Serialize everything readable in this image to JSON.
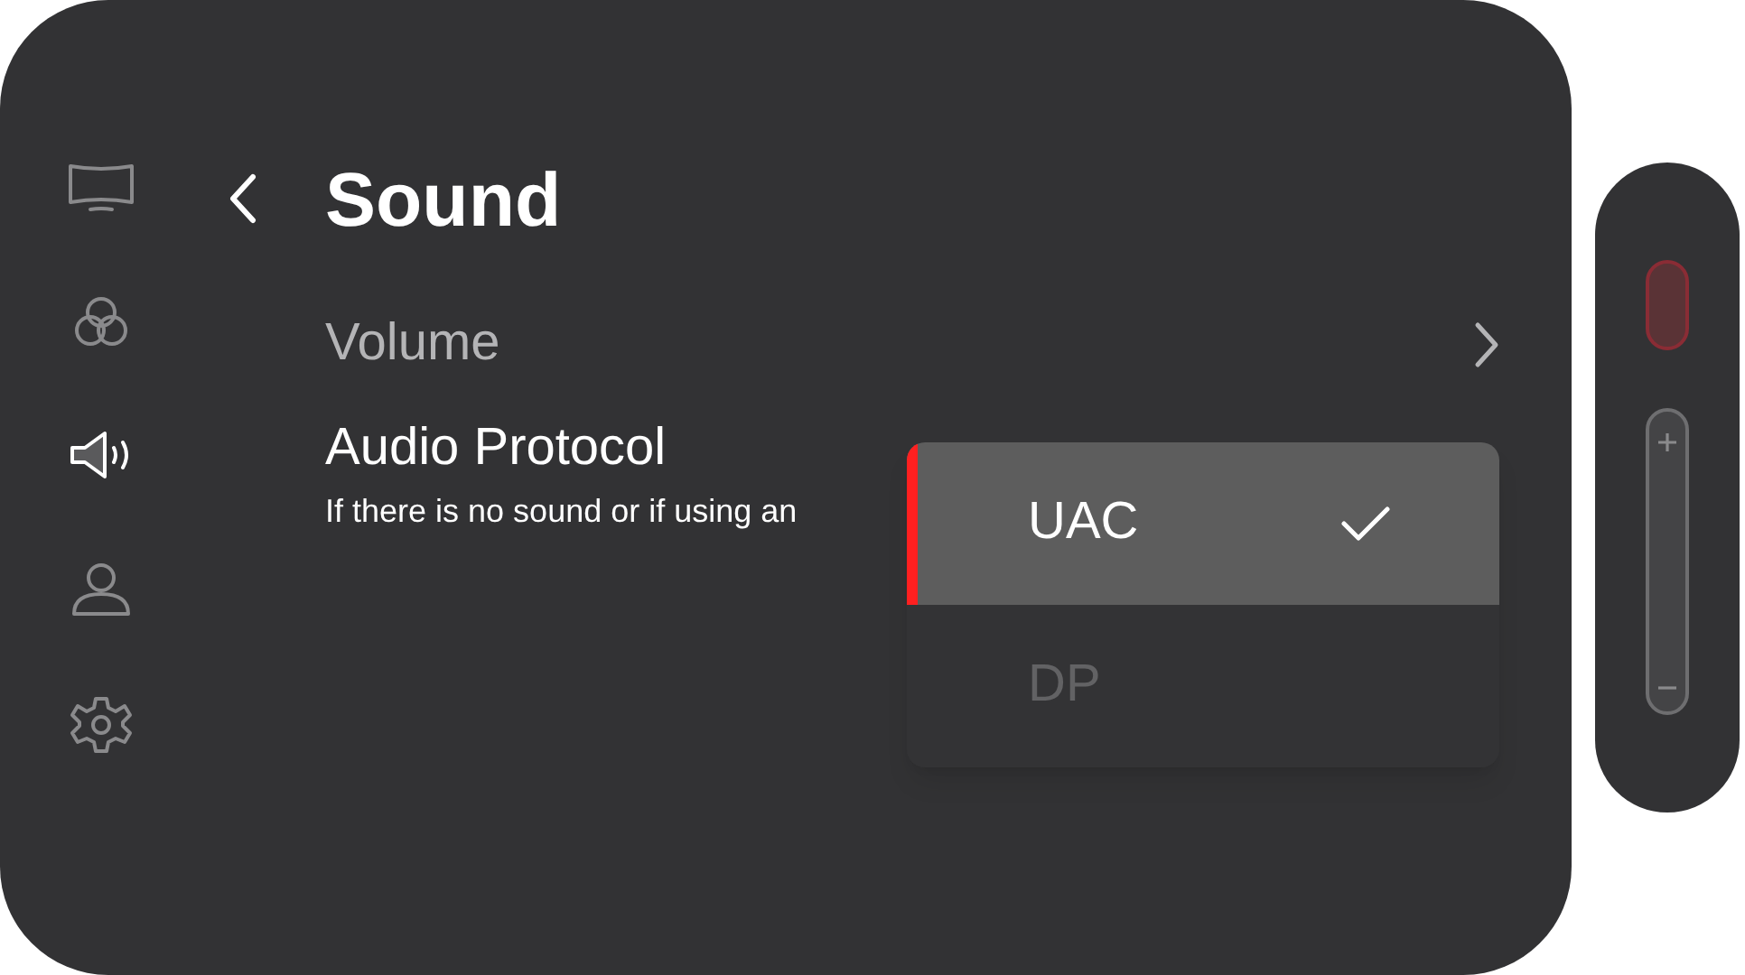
{
  "sidebar": {
    "items": [
      {
        "kind": "display",
        "selected": false
      },
      {
        "kind": "color",
        "selected": false
      },
      {
        "kind": "sound",
        "selected": true
      },
      {
        "kind": "user",
        "selected": false
      },
      {
        "kind": "settings",
        "selected": false
      }
    ]
  },
  "header": {
    "title": "Sound"
  },
  "settings": [
    {
      "kind": "link",
      "label": "Volume"
    },
    {
      "kind": "option",
      "label": "Audio Protocol",
      "description": "If there is no sound or if using an"
    }
  ],
  "dropdown": {
    "options": [
      {
        "label": "UAC",
        "selected": true
      },
      {
        "label": "DP",
        "selected": false
      }
    ]
  }
}
